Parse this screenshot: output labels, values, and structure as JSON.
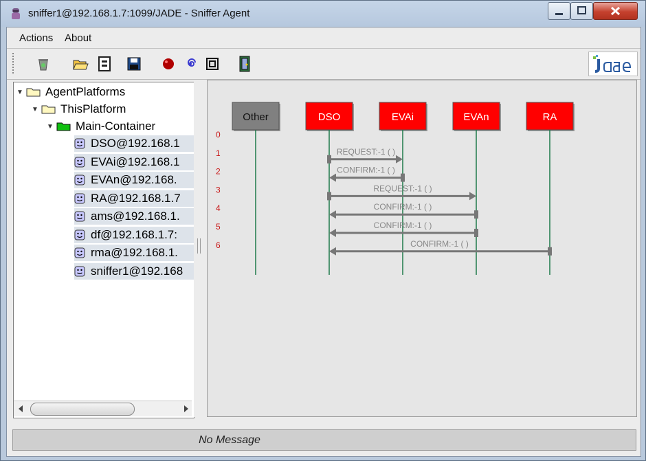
{
  "window": {
    "title": "sniffer1@192.168.1.7:1099/JADE - Sniffer Agent"
  },
  "menubar": {
    "items": [
      {
        "label": "Actions"
      },
      {
        "label": "About"
      }
    ]
  },
  "toolbar": {
    "buttons": [
      {
        "icon": "clear-canvas-icon"
      },
      {
        "icon": "open-folder-icon"
      },
      {
        "icon": "write-messages-icon"
      },
      {
        "icon": "save-icon"
      },
      {
        "icon": "record-icon"
      },
      {
        "icon": "spiral-icon"
      },
      {
        "icon": "filter-icon"
      },
      {
        "icon": "exit-door-icon"
      }
    ],
    "logo_icon": "jade-logo"
  },
  "tree": {
    "root": "AgentPlatforms",
    "platform": "ThisPlatform",
    "container": "Main-Container",
    "agents": [
      "DSO@192.168.1",
      "EVAi@192.168.1",
      "EVAn@192.168.",
      "RA@192.168.1.7",
      "ams@192.168.1.",
      "df@192.168.1.7:",
      "rma@192.168.1.",
      "sniffer1@192.168"
    ]
  },
  "diagram": {
    "agents": [
      {
        "name": "Other",
        "color": "#808080"
      },
      {
        "name": "DSO",
        "color": "#ff0000"
      },
      {
        "name": "EVAi",
        "color": "#ff0000"
      },
      {
        "name": "EVAn",
        "color": "#ff0000"
      },
      {
        "name": "RA",
        "color": "#ff0000"
      }
    ],
    "messages": [
      {
        "index": "0",
        "label": "",
        "from": null,
        "to": null
      },
      {
        "index": "1",
        "label": "REQUEST:-1 (     )",
        "from": 1,
        "to": 2
      },
      {
        "index": "2",
        "label": "CONFIRM:-1 (     )",
        "from": 2,
        "to": 1
      },
      {
        "index": "3",
        "label": "REQUEST:-1 (     )",
        "from": 1,
        "to": 3
      },
      {
        "index": "4",
        "label": "CONFIRM:-1 (     )",
        "from": 3,
        "to": 1
      },
      {
        "index": "5",
        "label": "CONFIRM:-1 (     )",
        "from": 3,
        "to": 1
      },
      {
        "index": "6",
        "label": "CONFIRM:-1 (     )",
        "from": 4,
        "to": 1
      }
    ]
  },
  "status": {
    "message": "No Message"
  }
}
